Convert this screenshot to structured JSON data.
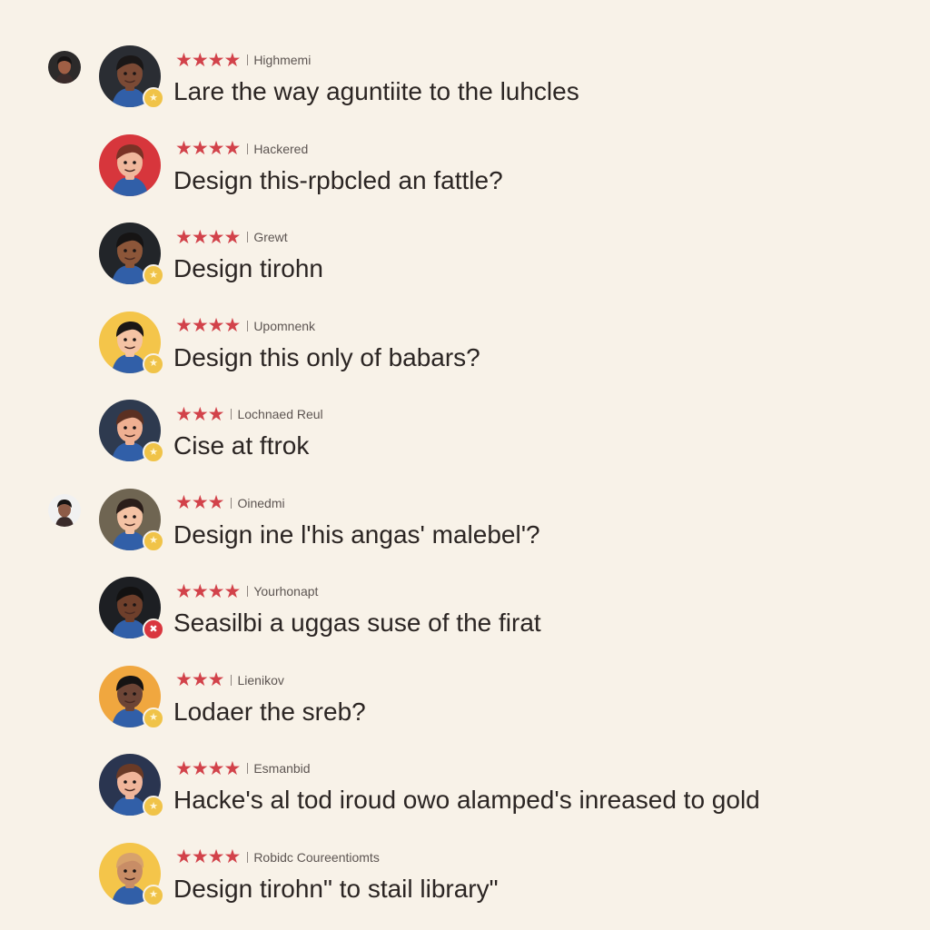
{
  "reviews": [
    {
      "stars": "★★★★",
      "rating": 4,
      "user": "Highmemi",
      "comment": "Lare the way aguntiite to the luhcles",
      "bg": "#2a2d33",
      "skin": "#7b4a35",
      "hair": "#1a1717",
      "badge": "gold"
    },
    {
      "stars": "★★★★",
      "rating": 4,
      "user": "Hackered",
      "comment": "Design this-rpbcled an fattle?",
      "bg": "#d7363c",
      "skin": "#f0b79c",
      "hair": "#7a3226",
      "badge": "none"
    },
    {
      "stars": "★★★★",
      "rating": 4,
      "user": "Grewt",
      "comment": "Design tirohn",
      "bg": "#222529",
      "skin": "#8c5639",
      "hair": "#161414",
      "badge": "gold"
    },
    {
      "stars": "★★★★",
      "rating": 4,
      "user": "Upomnenk",
      "comment": "Design this only of babars?",
      "bg": "#f4c54a",
      "skin": "#f4c3a4",
      "hair": "#1b1716",
      "badge": "gold"
    },
    {
      "stars": "★★★",
      "rating": 3,
      "user": "Lochnaed Reul",
      "comment": "Cise at ftrok",
      "bg": "#2e3a4f",
      "skin": "#efb092",
      "hair": "#5b3022",
      "badge": "gold"
    },
    {
      "stars": "★★★",
      "rating": 3,
      "user": "Oinedmi",
      "comment": "Design ine l'his angas' malebel'?",
      "bg": "#6f6552",
      "skin": "#f4c2a4",
      "hair": "#2a1d19",
      "badge": "gold"
    },
    {
      "stars": "★★★★",
      "rating": 4,
      "user": "Yourhonapt",
      "comment": "Seasilbi a uggas suse of the firat",
      "bg": "#1d1f23",
      "skin": "#6e3f2b",
      "hair": "#121111",
      "badge": "red"
    },
    {
      "stars": "★★★",
      "rating": 3,
      "user": "Lienikov",
      "comment": "Lodaer the sreb?",
      "bg": "#f0a73f",
      "skin": "#6d4536",
      "hair": "#151313",
      "badge": "gold"
    },
    {
      "stars": "★★★★",
      "rating": 4,
      "user": "Esmanbid",
      "comment": "Hacke's al tod iroud owo alamped's inreased to gold",
      "bg": "#2a3550",
      "skin": "#f0b59a",
      "hair": "#6a3a26",
      "badge": "gold"
    },
    {
      "stars": "★★★★",
      "rating": 4,
      "user": "Robidc Coureentiomts",
      "comment": "Design tirohn\" to stail library\"",
      "bg": "#f4c54a",
      "skin": "#c88d66",
      "hair": "#d7a26c",
      "badge": "gold"
    }
  ],
  "side_avatars": [
    {
      "row": 0,
      "bg": "#2c2a2a",
      "skin": "#a05f45"
    },
    {
      "row": 5,
      "bg": "#f1f1f1",
      "skin": "#8d5b47"
    }
  ],
  "colors": {
    "background": "#f8f2e8",
    "star": "#d2424a",
    "text": "#2b2523",
    "badge_gold": "#f0c348",
    "badge_red": "#d9363e"
  },
  "icons": {
    "badge_gold": "star-badge-icon",
    "badge_red": "flag-badge-icon"
  }
}
